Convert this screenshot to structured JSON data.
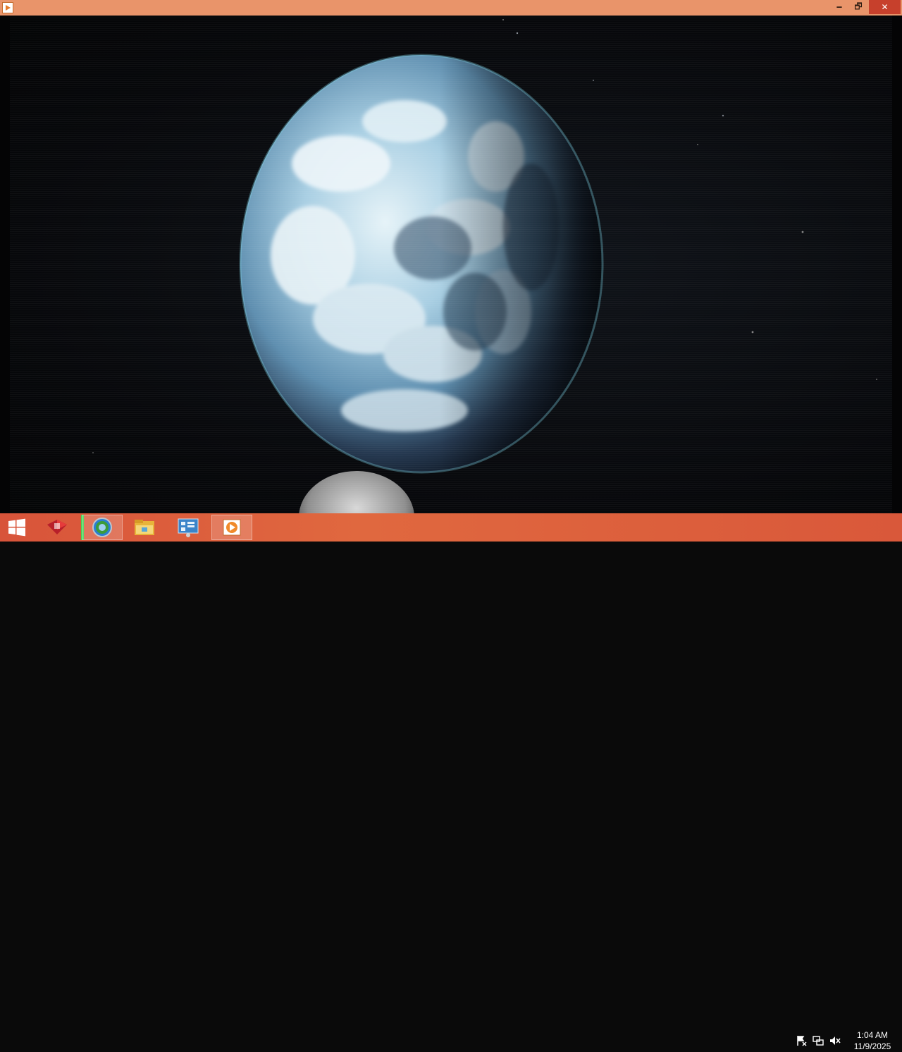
{
  "window": {
    "controls": {
      "minimize": "🗕",
      "maximize": "🗗",
      "close": "✕"
    },
    "title_color": "#e9946a",
    "app_icon": "media-player-icon"
  },
  "video": {
    "subject": "earth-planet",
    "planet_colors": {
      "light": "#d9eef6",
      "mid": "#6aa1c4",
      "dark": "#1b2b3d"
    }
  },
  "taskbar": {
    "start_icon": "windows-logo-icon",
    "pinned": [
      {
        "id": "app-red-icon",
        "active": false
      },
      {
        "id": "browser-globe-icon",
        "active": true
      },
      {
        "id": "file-explorer-icon",
        "active": false
      },
      {
        "id": "control-panel-icon",
        "active": false
      },
      {
        "id": "media-player-icon",
        "active": true
      }
    ],
    "tray": [
      "action-center-flag-icon",
      "network-icon",
      "volume-muted-icon"
    ],
    "clock": {
      "time": "1:04 AM",
      "date": "11/9/2025"
    },
    "accent": "#d8543a"
  }
}
